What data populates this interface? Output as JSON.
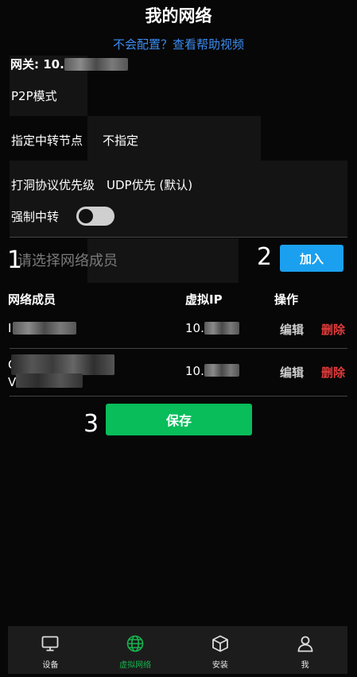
{
  "page": {
    "title": "我的网络",
    "help_link": "不会配置？查看帮助视频"
  },
  "settings": {
    "gateway_label": "网关: 10.",
    "p2p_label": "P2P模式",
    "relay_node_label": "指定中转节点",
    "relay_node_value": "不指定",
    "punch_priority_label": "打洞协议优先级",
    "punch_priority_value": "UDP优先 (默认)",
    "force_relay_label": "强制中转",
    "force_relay_on": false
  },
  "add_member": {
    "placeholder": "请选择网络成员",
    "join_label": "加入"
  },
  "annotations": [
    "1",
    "2",
    "3"
  ],
  "table": {
    "headers": [
      "网络成员",
      "虚拟IP",
      "操作"
    ],
    "rows": [
      {
        "member": "I",
        "ip": "10.",
        "edit": "编辑",
        "delete": "删除"
      },
      {
        "member": "O",
        "member_line2": "V",
        "ip": "10.",
        "edit": "编辑",
        "delete": "删除"
      }
    ]
  },
  "save_label": "保存",
  "tabs": [
    {
      "label": "设备",
      "icon": "monitor-icon",
      "active": false
    },
    {
      "label": "虚拟网络",
      "icon": "globe-icon",
      "active": true
    },
    {
      "label": "安装",
      "icon": "package-icon",
      "active": false
    },
    {
      "label": "我",
      "icon": "user-icon",
      "active": false
    }
  ],
  "colors": {
    "background": "#070707",
    "link": "#3b8cf0",
    "join_button": "#1aa0ef",
    "save_button": "#08bd5a",
    "delete": "#e23b3b",
    "active_tab": "#17b34f"
  }
}
